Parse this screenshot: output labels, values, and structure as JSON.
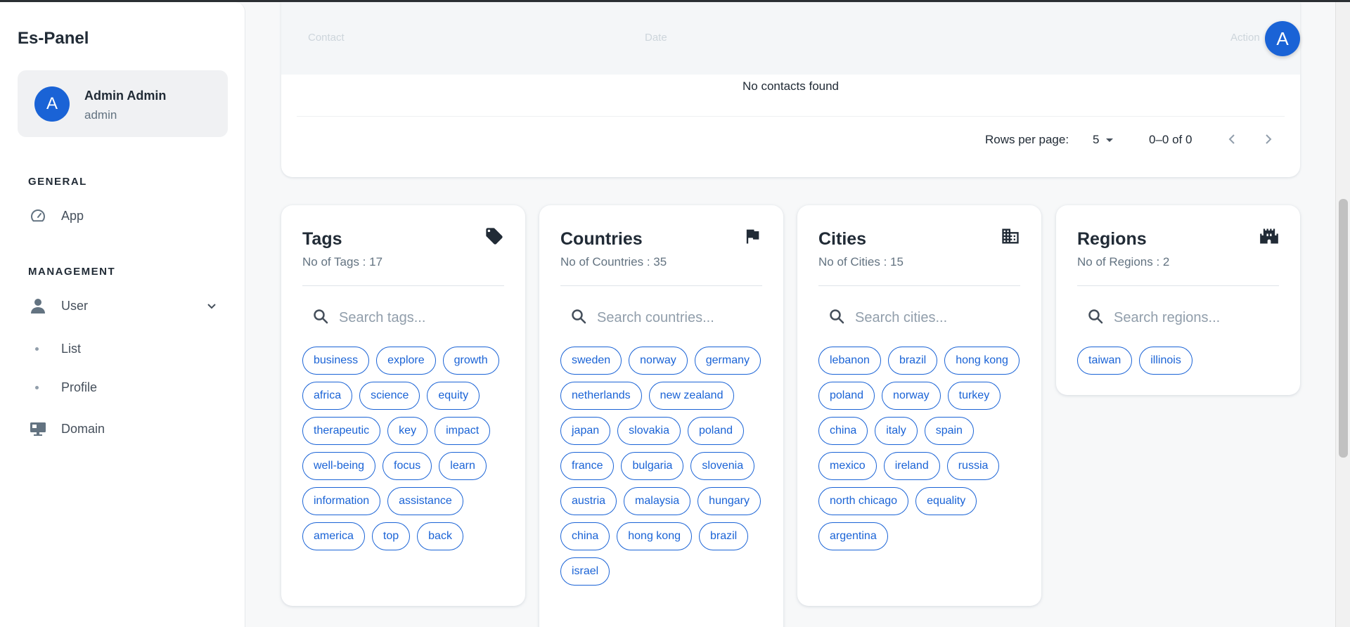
{
  "sidebar": {
    "brand": "Es-Panel",
    "user": {
      "avatar_letter": "A",
      "name": "Admin Admin",
      "role": "admin"
    },
    "sections": [
      {
        "title": "GENERAL"
      },
      {
        "title": "MANAGEMENT"
      }
    ],
    "items": {
      "app": "App",
      "user": "User",
      "list": "List",
      "profile": "Profile",
      "domain": "Domain"
    }
  },
  "header": {
    "avatar_letter": "A"
  },
  "contacts_table": {
    "columns": [
      "Contact",
      "Date",
      "Action"
    ],
    "empty_message": "No contacts found",
    "rows_per_page_label": "Rows per page:",
    "rows_per_page_value": "5",
    "page_range": "0–0 of 0"
  },
  "cards": {
    "tags": {
      "title": "Tags",
      "count": "No of Tags : 17",
      "placeholder": "Search tags...",
      "items": [
        "business",
        "explore",
        "growth",
        "africa",
        "science",
        "equity",
        "therapeutic",
        "key",
        "impact",
        "well-being",
        "focus",
        "learn",
        "information",
        "assistance",
        "america",
        "top",
        "back"
      ]
    },
    "countries": {
      "title": "Countries",
      "count": "No of Countries : 35",
      "placeholder": "Search countries...",
      "items": [
        "sweden",
        "norway",
        "germany",
        "netherlands",
        "new zealand",
        "japan",
        "slovakia",
        "poland",
        "france",
        "bulgaria",
        "slovenia",
        "austria",
        "malaysia",
        "hungary",
        "china",
        "hong kong",
        "brazil",
        "israel"
      ]
    },
    "cities": {
      "title": "Cities",
      "count": "No of Cities : 15",
      "placeholder": "Search cities...",
      "items": [
        "lebanon",
        "brazil",
        "hong kong",
        "poland",
        "norway",
        "turkey",
        "china",
        "italy",
        "spain",
        "mexico",
        "ireland",
        "russia",
        "north chicago",
        "equality",
        "argentina"
      ]
    },
    "regions": {
      "title": "Regions",
      "count": "No of Regions : 2",
      "placeholder": "Search regions...",
      "items": [
        "taiwan",
        "illinois"
      ]
    }
  },
  "colors": {
    "primary": "#1a63d6",
    "text": "#212b36",
    "muted": "#637381"
  }
}
